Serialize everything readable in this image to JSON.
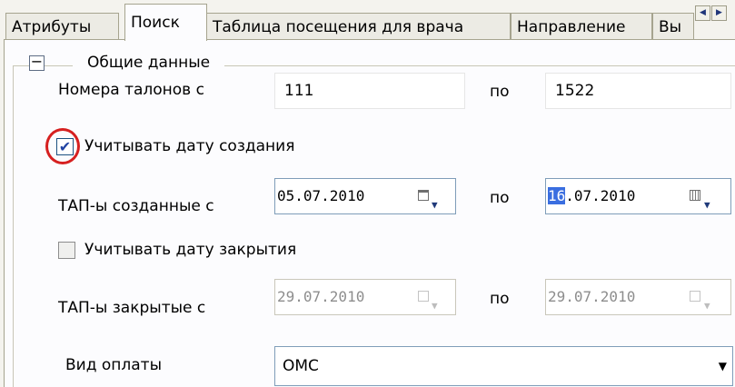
{
  "tabs": [
    {
      "label": "Атрибуты"
    },
    {
      "label": "Поиск"
    },
    {
      "label": "Таблица посещения для врача"
    },
    {
      "label": "Направление"
    },
    {
      "label": "Вы"
    }
  ],
  "tab_scroll": {
    "left": "◀",
    "right": "▶"
  },
  "group": {
    "title": "Общие данные",
    "collapse_symbol": "−"
  },
  "ticket": {
    "label": "Номера талонов с",
    "from": "111",
    "to_label": "по",
    "to": "1522"
  },
  "creation": {
    "checkbox_label": "Учитывать дату создания",
    "checked": true,
    "label": "ТАП-ы созданные с",
    "from": "05.07.2010",
    "to_label": "по",
    "to_selected": "16",
    "to_rest": ".07.2010"
  },
  "closing": {
    "checkbox_label": "Учитывать дату закрытия",
    "checked": false,
    "label": "ТАП-ы закрытые с",
    "from": "29.07.2010",
    "to_label": "по",
    "to": "29.07.2010"
  },
  "payment": {
    "label": "Вид оплаты",
    "value": "ОМС"
  },
  "colors": {
    "highlight": "#3a6ee0",
    "annotation": "#d62020",
    "panel": "#fcfcfe"
  }
}
